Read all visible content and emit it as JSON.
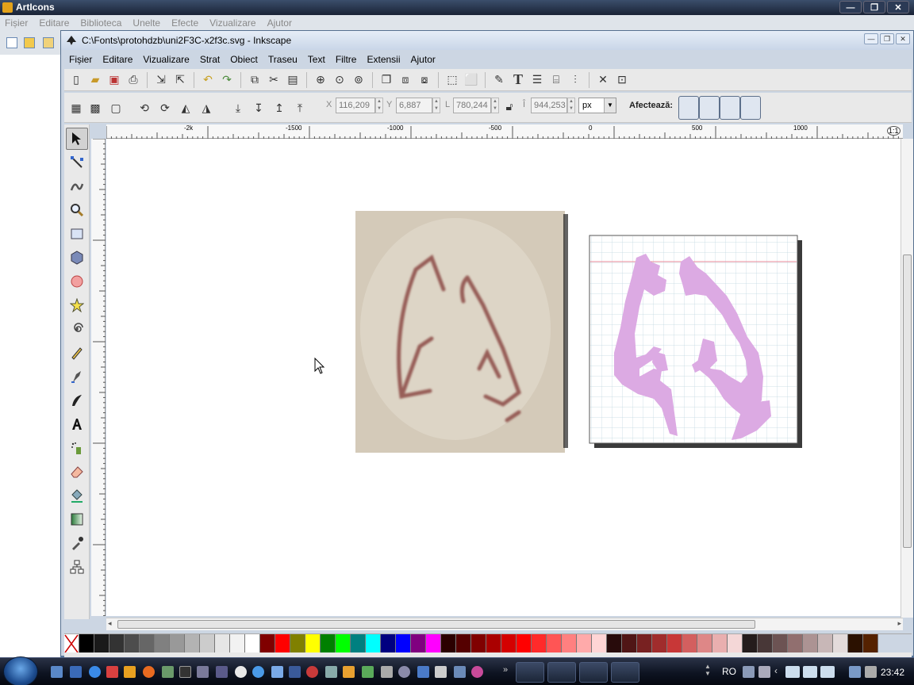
{
  "bg_app": {
    "title": "ArtIcons",
    "menu": [
      "Fișier",
      "Editare",
      "Biblioteca",
      "Unelte",
      "Efecte",
      "Vizualizare",
      "Ajutor"
    ]
  },
  "window": {
    "title": "C:\\Fonts\\protohdzb\\uni2F3C-x2f3c.svg - Inkscape",
    "menu": [
      "Fișier",
      "Editare",
      "Vizualizare",
      "Strat",
      "Obiect",
      "Traseu",
      "Text",
      "Filtre",
      "Extensii",
      "Ajutor"
    ]
  },
  "toolbar2": {
    "x_label": "X",
    "x_value": "116,209",
    "y_label": "Y",
    "y_value": "6,887",
    "w_label": "L",
    "w_value": "780,244",
    "h_label": "Î",
    "h_value": "944,253",
    "unit": "px",
    "affects_label": "Afectează:"
  },
  "ruler": {
    "labels": [
      "-2k",
      "-1500",
      "-1000",
      "-500",
      "0",
      "500",
      "1000",
      "1:1"
    ]
  },
  "taskbar": {
    "language": "RO",
    "clock": "23:42"
  },
  "colors": {
    "glyph": "#dcaae3",
    "grid": "#bfd6e0",
    "guide": "#e88a9a",
    "taskbar": "#0e1422"
  },
  "palette": [
    "#000000",
    "#1a1a1a",
    "#333333",
    "#4d4d4d",
    "#666666",
    "#808080",
    "#999999",
    "#b3b3b3",
    "#cccccc",
    "#e6e6e6",
    "#f2f2f2",
    "#ffffff",
    "#800000",
    "#ff0000",
    "#808000",
    "#ffff00",
    "#008000",
    "#00ff00",
    "#008080",
    "#00ffff",
    "#000080",
    "#0000ff",
    "#800080",
    "#ff00ff",
    "#2b0000",
    "#550000",
    "#800000",
    "#aa0000",
    "#d40000",
    "#ff0000",
    "#ff2a2a",
    "#ff5555",
    "#ff8080",
    "#ffaaaa",
    "#ffd5d5",
    "#280b0b",
    "#501616",
    "#782121",
    "#a02c2c",
    "#c83737",
    "#d35f5f",
    "#de8787",
    "#e9afaf",
    "#f4d7d7",
    "#241c1c",
    "#483737",
    "#6c5353",
    "#916f6f",
    "#ac9393",
    "#c8b7b7",
    "#e3dbdb",
    "#2b1100",
    "#552200"
  ]
}
